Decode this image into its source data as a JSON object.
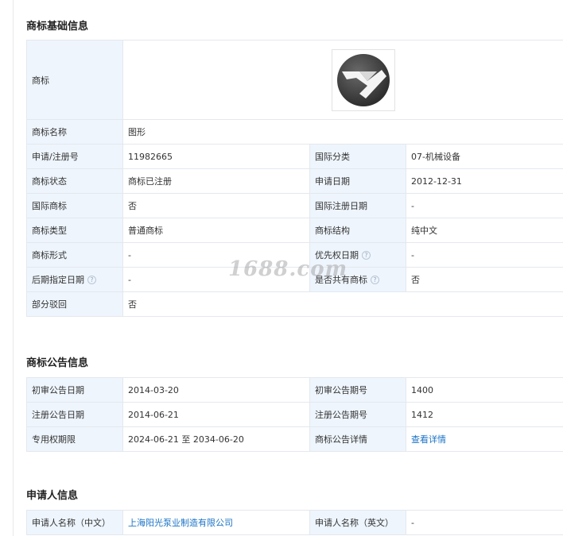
{
  "basic": {
    "title": "商标基础信息",
    "rows": {
      "logo_label": "商标",
      "name_label": "商标名称",
      "name_value": "图形",
      "reg_no_label": "申请/注册号",
      "reg_no_value": "11982665",
      "intl_class_label": "国际分类",
      "intl_class_value": "07-机械设备",
      "status_label": "商标状态",
      "status_value": "商标已注册",
      "apply_date_label": "申请日期",
      "apply_date_value": "2012-12-31",
      "intl_mark_label": "国际商标",
      "intl_mark_value": "否",
      "intl_reg_date_label": "国际注册日期",
      "intl_reg_date_value": "-",
      "type_label": "商标类型",
      "type_value": "普通商标",
      "structure_label": "商标结构",
      "structure_value": "纯中文",
      "form_label": "商标形式",
      "form_value": "-",
      "priority_date_label": "优先权日期",
      "priority_date_value": "-",
      "later_date_label": "后期指定日期",
      "later_date_value": "-",
      "shared_label": "是否共有商标",
      "shared_value": "否",
      "partial_reject_label": "部分驳回",
      "partial_reject_value": "否"
    }
  },
  "announce": {
    "title": "商标公告信息",
    "rows": {
      "prelim_date_label": "初审公告日期",
      "prelim_date_value": "2014-03-20",
      "prelim_no_label": "初审公告期号",
      "prelim_no_value": "1400",
      "reg_date_label": "注册公告日期",
      "reg_date_value": "2014-06-21",
      "reg_no_label": "注册公告期号",
      "reg_no_value": "1412",
      "exclusive_label": "专用权期限",
      "exclusive_value": "2024-06-21 至 2034-06-20",
      "detail_label": "商标公告详情",
      "detail_link": "查看详情"
    }
  },
  "applicant": {
    "title": "申请人信息",
    "rows": {
      "name_cn_label": "申请人名称（中文）",
      "name_cn_value": "上海阳光泵业制造有限公司",
      "name_en_label": "申请人名称（英文）",
      "name_en_value": "-"
    }
  },
  "watermark": "1688.com",
  "colors": {
    "label_bg": "#eef5fd",
    "border": "#e4e8ee",
    "link": "#1a73c6"
  },
  "icons": {
    "help": "question-circle-icon"
  }
}
